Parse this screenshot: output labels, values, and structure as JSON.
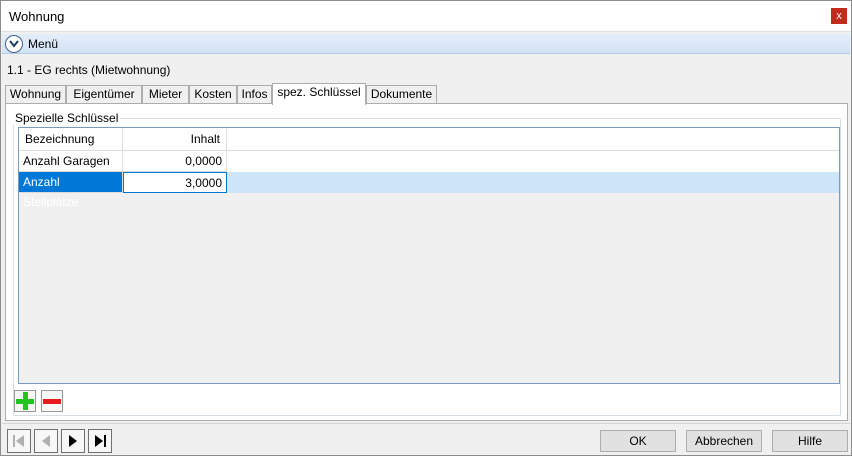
{
  "window": {
    "title": "Wohnung",
    "close_label": "x"
  },
  "menu": {
    "label": "Menü"
  },
  "record": {
    "title": "1.1 - EG rechts (Mietwohnung)"
  },
  "tabs": [
    {
      "label": "Wohnung"
    },
    {
      "label": "Eigentümer"
    },
    {
      "label": "Mieter"
    },
    {
      "label": "Kosten"
    },
    {
      "label": "Infos"
    },
    {
      "label": "spez. Schlüssel",
      "active": true
    },
    {
      "label": "Dokumente"
    }
  ],
  "group": {
    "title": "Spezielle Schlüssel"
  },
  "grid": {
    "columns": [
      "Bezeichnung",
      "Inhalt"
    ],
    "rows": [
      {
        "name": "Anzahl Garagen",
        "value": "0,0000"
      },
      {
        "name": "Anzahl Stellplätze",
        "value": "3,0000",
        "selected": true
      }
    ]
  },
  "footer": {
    "ok_label": "OK",
    "cancel_label": "Abbrechen",
    "help_label": "Hilfe"
  },
  "icons": {
    "add": "plus-icon",
    "remove": "minus-icon",
    "first": "first-record-icon",
    "prev": "prev-record-icon",
    "next": "next-record-icon",
    "last": "last-record-icon"
  },
  "colors": {
    "selection": "#0078d7",
    "selected_row": "#cde6f7",
    "add_green": "#22c422",
    "remove_red": "#e81c1c",
    "close_red": "#c42b1c"
  }
}
